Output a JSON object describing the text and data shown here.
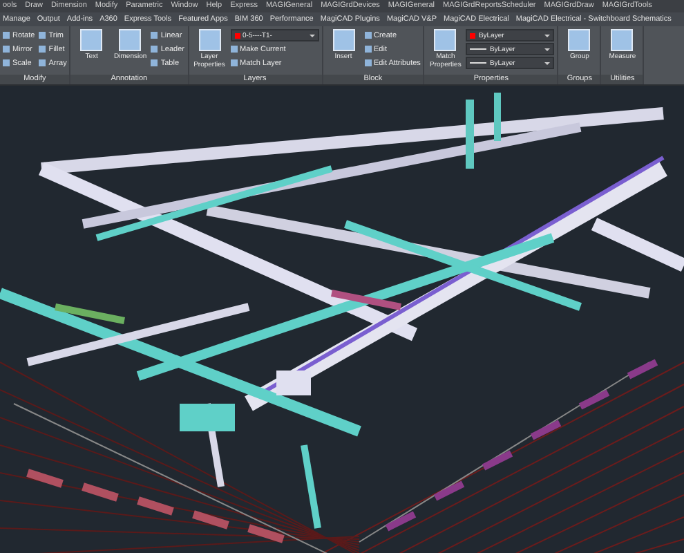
{
  "menu_bar": [
    "ools",
    "Draw",
    "Dimension",
    "Modify",
    "Parametric",
    "Window",
    "Help",
    "Express",
    "MAGIGeneral",
    "MAGIGrdDevices",
    "MAGIGeneral",
    "MAGIGrdReportsScheduler",
    "MAGIGrdDraw",
    "MAGIGrdTools"
  ],
  "ribbon_tabs": [
    {
      "label": "Manage",
      "selected": false
    },
    {
      "label": "Output",
      "selected": false
    },
    {
      "label": "Add-ins",
      "selected": false
    },
    {
      "label": "A360",
      "selected": false
    },
    {
      "label": "Express Tools",
      "selected": false
    },
    {
      "label": "Featured Apps",
      "selected": false
    },
    {
      "label": "BIM 360",
      "selected": false
    },
    {
      "label": "Performance",
      "selected": false
    },
    {
      "label": "MagiCAD Plugins",
      "selected": false
    },
    {
      "label": "MagiCAD V&P",
      "selected": false
    },
    {
      "label": "MagiCAD Electrical",
      "selected": false
    },
    {
      "label": "MagiCAD Electrical - Switchboard Schematics",
      "selected": false
    }
  ],
  "panels": [
    {
      "title": "Modify",
      "tools": [
        {
          "kind": "small",
          "label": "Rotate"
        },
        {
          "kind": "small",
          "label": "Mirror"
        },
        {
          "kind": "small",
          "label": "Scale"
        },
        {
          "kind": "small",
          "label": "Trim"
        },
        {
          "kind": "small",
          "label": "Fillet"
        },
        {
          "kind": "small",
          "label": "Array"
        }
      ]
    },
    {
      "title": "Annotation",
      "tools": [
        {
          "kind": "large",
          "label": "Text"
        },
        {
          "kind": "large",
          "label": "Dimension"
        },
        {
          "kind": "small",
          "label": "Linear"
        },
        {
          "kind": "small",
          "label": "Leader"
        },
        {
          "kind": "small",
          "label": "Table"
        }
      ]
    },
    {
      "title": "Layers",
      "tools": [
        {
          "kind": "large",
          "label": "Layer Properties"
        },
        {
          "kind": "dropdown",
          "label": "0-5----T1-",
          "color": "#ff0000"
        },
        {
          "kind": "small",
          "label": "Make Current"
        },
        {
          "kind": "small",
          "label": "Match Layer"
        }
      ]
    },
    {
      "title": "Block",
      "tools": [
        {
          "kind": "large",
          "label": "Insert"
        },
        {
          "kind": "small",
          "label": "Create"
        },
        {
          "kind": "small",
          "label": "Edit"
        },
        {
          "kind": "small",
          "label": "Edit Attributes"
        }
      ]
    },
    {
      "title": "Properties",
      "tools": [
        {
          "kind": "large",
          "label": "Match Properties"
        },
        {
          "kind": "dropdown",
          "label": "ByLayer",
          "color": "#ff0000"
        },
        {
          "kind": "dropdown",
          "label": "ByLayer"
        },
        {
          "kind": "dropdown",
          "label": "ByLayer"
        }
      ]
    },
    {
      "title": "Groups",
      "tools": [
        {
          "kind": "large",
          "label": "Group"
        }
      ]
    },
    {
      "title": "Utilities",
      "tools": [
        {
          "kind": "large",
          "label": "Measure"
        }
      ]
    }
  ]
}
